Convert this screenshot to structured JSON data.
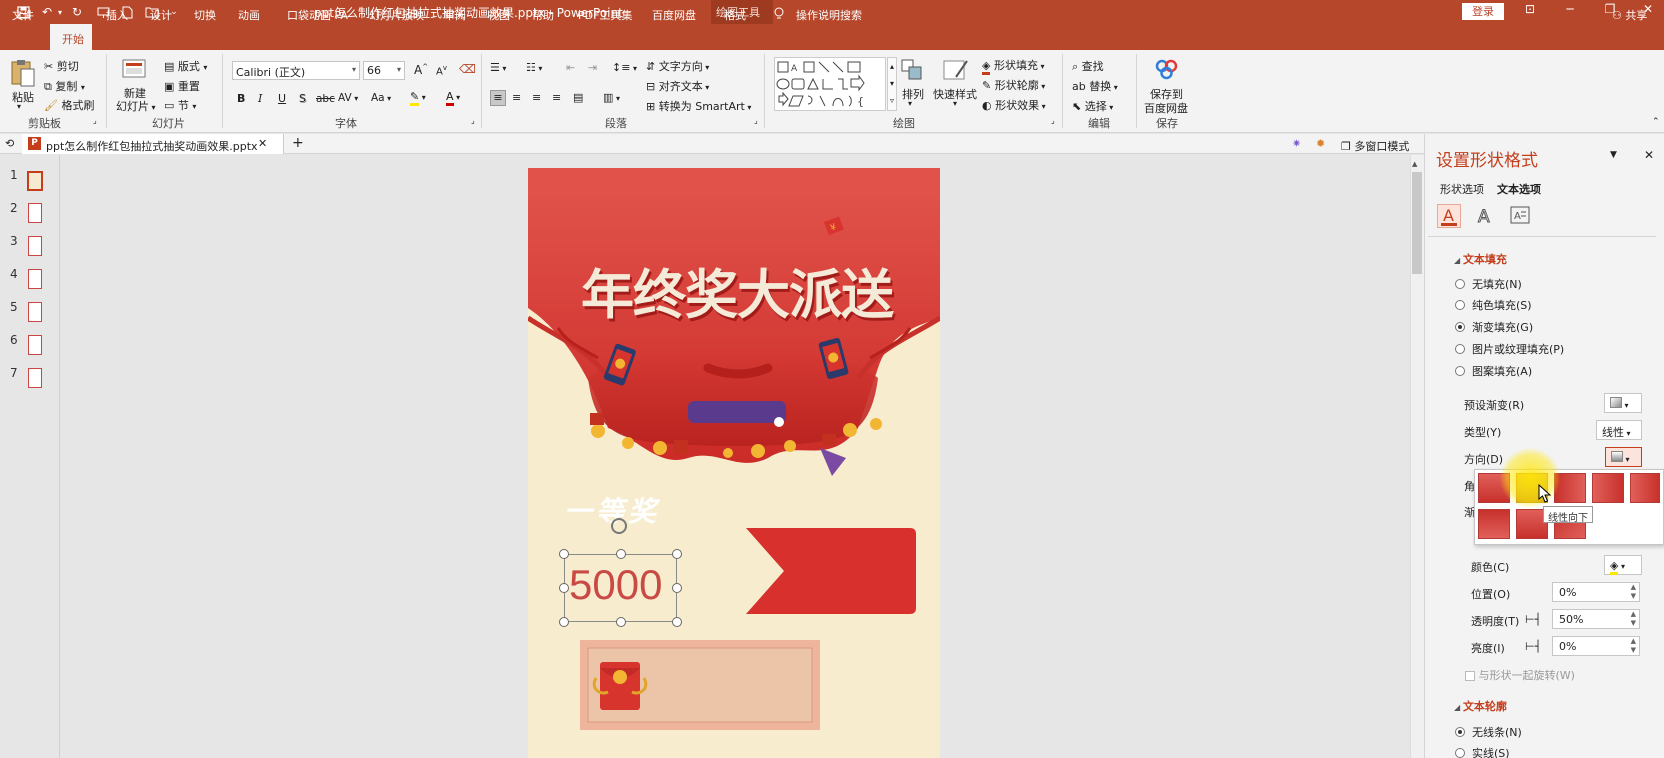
{
  "window": {
    "title": "ppt怎么制作红包抽拉式抽奖动画效果.pptx - PowerPoint",
    "context_tab": "绘图工具",
    "login": "登录",
    "share": "共享"
  },
  "ribbon_tabs": [
    "文件",
    "开始",
    "插入",
    "设计",
    "切换",
    "动画",
    "口袋动画 PA",
    "幻灯片放映",
    "审阅",
    "视图",
    "帮助",
    "PDF工具集",
    "百度网盘",
    "格式"
  ],
  "active_tab": "开始",
  "tell_me": "操作说明搜索",
  "clipboard": {
    "paste": "粘贴",
    "cut": "剪切",
    "copy": "复制",
    "format_painter": "格式刷",
    "group": "剪贴板"
  },
  "slides_group": {
    "new_slide": "新建\n幻灯片",
    "new_slide_l1": "新建",
    "new_slide_l2": "幻灯片",
    "layout": "版式",
    "reset": "重置",
    "section": "节",
    "group": "幻灯片"
  },
  "font_group": {
    "font_name": "Calibri (正文)",
    "font_size": "66",
    "bold": "B",
    "italic": "I",
    "underline": "U",
    "shadow": "S",
    "strike": "abc",
    "spacing": "AV",
    "case": "Aa",
    "grow": "A",
    "shrink": "A",
    "group": "字体"
  },
  "paragraph_group": {
    "text_direction": "文字方向",
    "align_text": "对齐文本",
    "smartart": "转换为 SmartArt",
    "group": "段落"
  },
  "drawing_group": {
    "arrange": "排列",
    "quick_styles": "快速样式",
    "shape_fill": "形状填充",
    "shape_outline": "形状轮廓",
    "shape_effects": "形状效果",
    "group": "绘图"
  },
  "editing_group": {
    "find": "查找",
    "replace": "替换",
    "select": "选择",
    "group": "编辑"
  },
  "save_group": {
    "save_baidu_l1": "保存到",
    "save_baidu_l2": "百度网盘",
    "group": "保存"
  },
  "doc_tab": {
    "filename": "ppt怎么制作红包抽拉式抽奖动画效果.pptx",
    "multiwindow": "多窗口模式"
  },
  "thumbnails": [
    "1",
    "2",
    "3",
    "4",
    "5",
    "6",
    "7"
  ],
  "selected_slide": 1,
  "slide": {
    "headline": "年终奖大派送",
    "prize_label": "一等奖",
    "amount": "5000"
  },
  "format_pane": {
    "title": "设置形状格式",
    "tab_shape": "形状选项",
    "tab_text": "文本选项",
    "section_fill": "文本填充",
    "fill_options": [
      "无填充(N)",
      "纯色填充(S)",
      "渐变填充(G)",
      "图片或纹理填充(P)",
      "图案填充(A)"
    ],
    "fill_selected": 2,
    "preset_gradient": "预设渐变(R)",
    "type_label": "类型(Y)",
    "type_value": "线性",
    "direction_label": "方向(D)",
    "angle_label": "角",
    "stops_label": "渐",
    "color_label": "颜色(C)",
    "position_label": "位置(O)",
    "position_value": "0%",
    "transparency_label": "透明度(T)",
    "transparency_value": "50%",
    "brightness_label": "亮度(I)",
    "brightness_value": "0%",
    "rotate_with_shape": "与形状一起旋转(W)",
    "section_outline": "文本轮廓",
    "outline_options": [
      "无线条(N)",
      "实线(S)"
    ],
    "outline_selected": 0,
    "tooltip": "线性向下"
  },
  "colors": {
    "accent": "#b7472a",
    "pane_accent": "#c43e1c",
    "slide_red": "#d8312d",
    "slide_cream": "#f7ecce"
  }
}
